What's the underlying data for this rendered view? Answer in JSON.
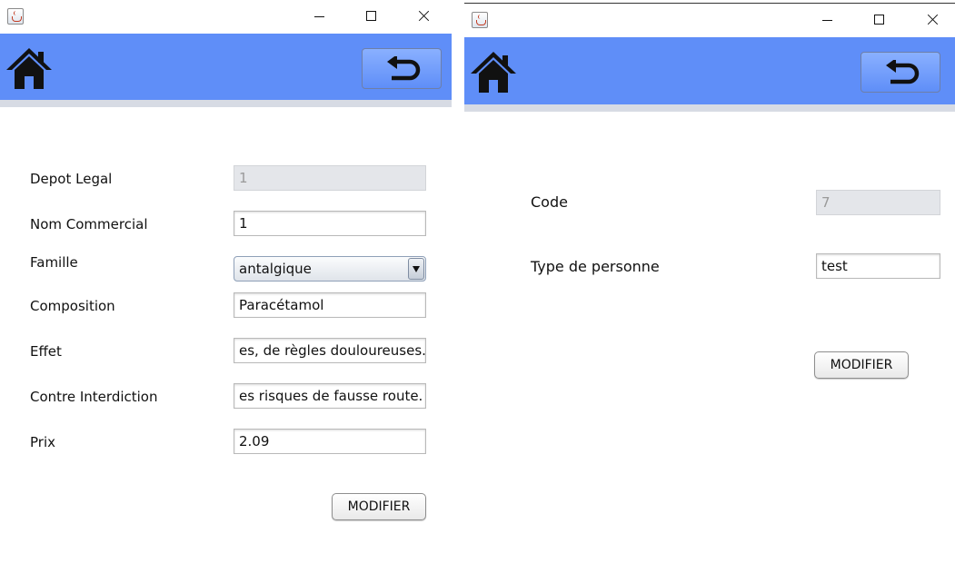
{
  "colors": {
    "header": "#5f8ef8",
    "header_border": "#d7dbe4",
    "disabled_field": "#e4e6ea"
  },
  "window1": {
    "form": {
      "depot_legal": {
        "label": "Depot Legal",
        "value": "1"
      },
      "nom_commercial": {
        "label": "Nom Commercial",
        "value": "1"
      },
      "famille": {
        "label": "Famille",
        "selected": "antalgique"
      },
      "composition": {
        "label": "Composition",
        "value": "Paracétamol"
      },
      "effet": {
        "label": "Effet",
        "value": "es, de règles douloureuses."
      },
      "contre_interdiction": {
        "label": "Contre Interdiction",
        "value": "es risques de fausse route."
      },
      "prix": {
        "label": "Prix",
        "value": "2.09"
      }
    },
    "modifier_label": "MODIFIER"
  },
  "window2": {
    "form": {
      "code": {
        "label": "Code",
        "value": "7"
      },
      "type_personne": {
        "label": "Type de personne",
        "value": "test"
      }
    },
    "modifier_label": "MODIFIER"
  },
  "icons": {
    "home": "home-icon",
    "back": "undo-arrow-icon",
    "app": "java-icon"
  }
}
